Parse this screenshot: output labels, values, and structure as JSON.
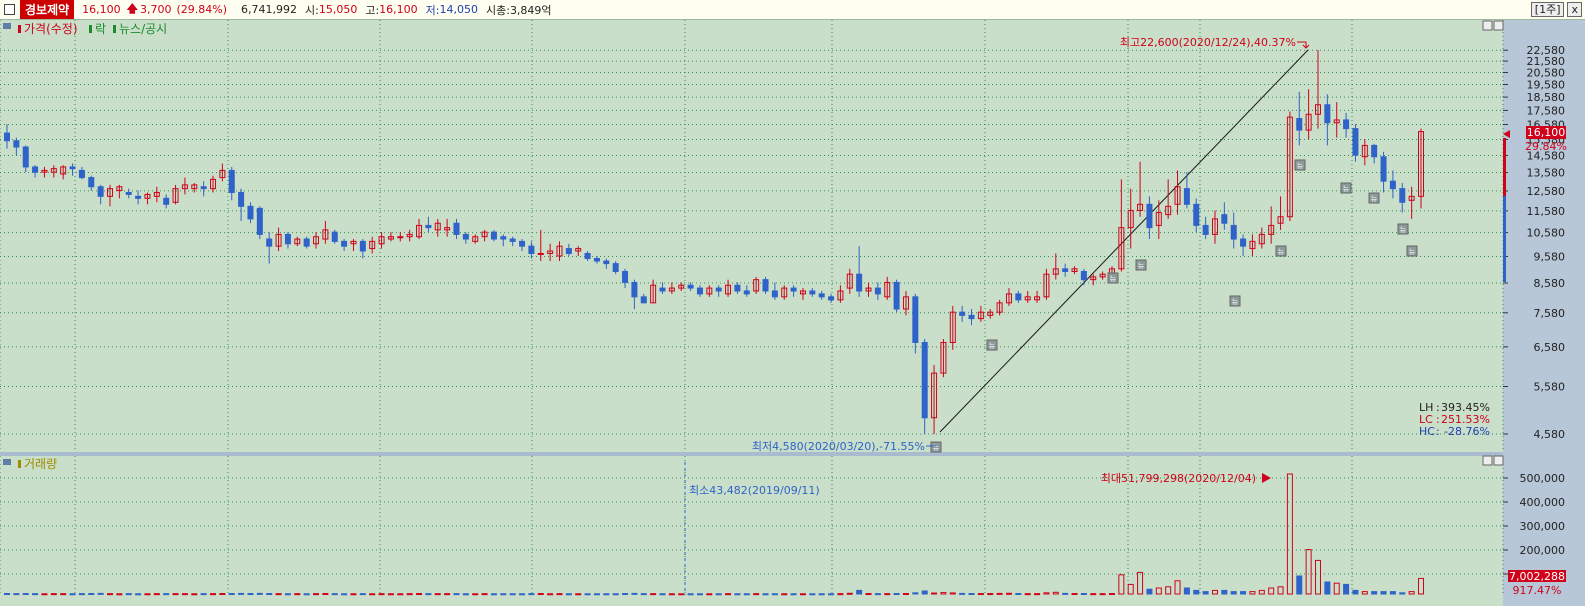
{
  "header": {
    "stock_name": "경보제약",
    "price": "16,100",
    "change": "3,700",
    "change_pct": "(29.84%)",
    "volume": "6,741,992",
    "open_label": "시:",
    "open": "15,050",
    "high_label": "고:",
    "high": "16,100",
    "low_label": "저:",
    "low": "14,050",
    "mcap_label": "시총:",
    "mcap": "3,849억",
    "period_button": "[1주]",
    "close_button": "x"
  },
  "price_panel": {
    "legend_price": "가격(수정)",
    "legend_rak": "락",
    "legend_news": "뉴스/공시",
    "max_annotation": "최고22,600(2020/12/24),40.37%",
    "min_annotation": "최저4,580(2020/03/20),-71.55%",
    "current_price_tag": "16,100",
    "current_pct_tag": "29.84%",
    "stats": [
      {
        "label": "LH",
        "value": "393.45%",
        "color": "#222222"
      },
      {
        "label": "LC",
        "value": "251.53%",
        "color": "#d0021b"
      },
      {
        "label": "HC",
        "value": "-28.76%",
        "color": "#1f3fb0"
      }
    ],
    "news_marker_glyph": "뉴"
  },
  "volume_panel": {
    "legend": "거래량",
    "min_annotation": "최소43,482(2019/09/11)",
    "max_annotation": "최대51,799,298(2020/12/04)",
    "current_volume_tag": "7,002,288",
    "current_pct_tag": "917.47%"
  },
  "colors": {
    "up": "#d0021b",
    "down": "#2f63c9",
    "background": "#c9dfc9",
    "grid": "#2d8f4e",
    "axis": "#b6c6d6"
  },
  "chart_data": {
    "type": "candlestick",
    "period": "weekly",
    "y_ticks": [
      "22,580",
      "21,580",
      "20,580",
      "19,580",
      "18,580",
      "17,580",
      "16,580",
      "15,580",
      "14,580",
      "13,580",
      "12,580",
      "11,580",
      "10,580",
      "9,580",
      "8,580",
      "7,580",
      "6,580",
      "5,580",
      "4,580"
    ],
    "ylim": [
      4580,
      22600
    ],
    "volume_ticks": [
      "500,000",
      "400,000",
      "300,000",
      "200,000",
      "100,000"
    ],
    "volume_unit_note": "",
    "candles": [
      {
        "o": 16000,
        "h": 16600,
        "l": 15000,
        "c": 15500
      },
      {
        "o": 15500,
        "h": 15700,
        "l": 14600,
        "c": 15100
      },
      {
        "o": 15100,
        "h": 15200,
        "l": 13600,
        "c": 13900
      },
      {
        "o": 13900,
        "h": 14000,
        "l": 13300,
        "c": 13600
      },
      {
        "o": 13600,
        "h": 13900,
        "l": 13300,
        "c": 13700
      },
      {
        "o": 13600,
        "h": 14000,
        "l": 13300,
        "c": 13800
      },
      {
        "o": 13500,
        "h": 14000,
        "l": 13200,
        "c": 13900
      },
      {
        "o": 13900,
        "h": 14100,
        "l": 13400,
        "c": 13800
      },
      {
        "o": 13700,
        "h": 13900,
        "l": 13200,
        "c": 13300
      },
      {
        "o": 13300,
        "h": 13400,
        "l": 12600,
        "c": 12800
      },
      {
        "o": 12800,
        "h": 12900,
        "l": 11900,
        "c": 12300
      },
      {
        "o": 12300,
        "h": 12900,
        "l": 11800,
        "c": 12700
      },
      {
        "o": 12600,
        "h": 12900,
        "l": 12200,
        "c": 12800
      },
      {
        "o": 12500,
        "h": 12700,
        "l": 12200,
        "c": 12400
      },
      {
        "o": 12300,
        "h": 12600,
        "l": 11900,
        "c": 12200
      },
      {
        "o": 12200,
        "h": 12500,
        "l": 11900,
        "c": 12400
      },
      {
        "o": 12300,
        "h": 12800,
        "l": 12000,
        "c": 12500
      },
      {
        "o": 12200,
        "h": 12400,
        "l": 11700,
        "c": 11900
      },
      {
        "o": 12000,
        "h": 12900,
        "l": 11900,
        "c": 12700
      },
      {
        "o": 12700,
        "h": 13300,
        "l": 12400,
        "c": 12900
      },
      {
        "o": 12700,
        "h": 13000,
        "l": 12500,
        "c": 12900
      },
      {
        "o": 12800,
        "h": 13100,
        "l": 12300,
        "c": 12700
      },
      {
        "o": 12700,
        "h": 13400,
        "l": 12500,
        "c": 13200
      },
      {
        "o": 13300,
        "h": 14100,
        "l": 13100,
        "c": 13700
      },
      {
        "o": 13700,
        "h": 13900,
        "l": 12100,
        "c": 12500
      },
      {
        "o": 12500,
        "h": 12700,
        "l": 11100,
        "c": 11800
      },
      {
        "o": 11800,
        "h": 12000,
        "l": 11000,
        "c": 11200
      },
      {
        "o": 11700,
        "h": 11800,
        "l": 10300,
        "c": 10500
      },
      {
        "o": 10300,
        "h": 10600,
        "l": 9300,
        "c": 10000
      },
      {
        "o": 10000,
        "h": 10800,
        "l": 9800,
        "c": 10500
      },
      {
        "o": 10500,
        "h": 10600,
        "l": 9900,
        "c": 10100
      },
      {
        "o": 10100,
        "h": 10400,
        "l": 10000,
        "c": 10300
      },
      {
        "o": 10300,
        "h": 10400,
        "l": 9900,
        "c": 10000
      },
      {
        "o": 10100,
        "h": 10600,
        "l": 9900,
        "c": 10400
      },
      {
        "o": 10300,
        "h": 11100,
        "l": 10100,
        "c": 10700
      },
      {
        "o": 10600,
        "h": 10700,
        "l": 10100,
        "c": 10200
      },
      {
        "o": 10200,
        "h": 10300,
        "l": 9800,
        "c": 10000
      },
      {
        "o": 10100,
        "h": 10300,
        "l": 9800,
        "c": 10200
      },
      {
        "o": 10200,
        "h": 10300,
        "l": 9500,
        "c": 9800
      },
      {
        "o": 9900,
        "h": 10400,
        "l": 9700,
        "c": 10200
      },
      {
        "o": 10100,
        "h": 10600,
        "l": 9900,
        "c": 10400
      },
      {
        "o": 10300,
        "h": 10600,
        "l": 10200,
        "c": 10400
      },
      {
        "o": 10400,
        "h": 10600,
        "l": 10200,
        "c": 10400
      },
      {
        "o": 10400,
        "h": 10700,
        "l": 10200,
        "c": 10500
      },
      {
        "o": 10400,
        "h": 11200,
        "l": 10300,
        "c": 10900
      },
      {
        "o": 10900,
        "h": 11300,
        "l": 10600,
        "c": 10800
      },
      {
        "o": 10700,
        "h": 11200,
        "l": 10400,
        "c": 11000
      },
      {
        "o": 10700,
        "h": 11200,
        "l": 10400,
        "c": 10800
      },
      {
        "o": 11000,
        "h": 11200,
        "l": 10300,
        "c": 10500
      },
      {
        "o": 10500,
        "h": 10600,
        "l": 10100,
        "c": 10300
      },
      {
        "o": 10200,
        "h": 10500,
        "l": 10100,
        "c": 10400
      },
      {
        "o": 10400,
        "h": 10700,
        "l": 10200,
        "c": 10600
      },
      {
        "o": 10600,
        "h": 10700,
        "l": 10200,
        "c": 10300
      },
      {
        "o": 10400,
        "h": 10500,
        "l": 10000,
        "c": 10300
      },
      {
        "o": 10300,
        "h": 10400,
        "l": 10000,
        "c": 10200
      },
      {
        "o": 10200,
        "h": 10300,
        "l": 9800,
        "c": 10000
      },
      {
        "o": 10000,
        "h": 10200,
        "l": 9500,
        "c": 9700
      },
      {
        "o": 9700,
        "h": 10700,
        "l": 9400,
        "c": 9700
      },
      {
        "o": 9700,
        "h": 10100,
        "l": 9400,
        "c": 9800
      },
      {
        "o": 9600,
        "h": 10200,
        "l": 9400,
        "c": 10000
      },
      {
        "o": 9900,
        "h": 10100,
        "l": 9600,
        "c": 9700
      },
      {
        "o": 9800,
        "h": 10000,
        "l": 9600,
        "c": 9900
      },
      {
        "o": 9700,
        "h": 9800,
        "l": 9400,
        "c": 9500
      },
      {
        "o": 9500,
        "h": 9600,
        "l": 9300,
        "c": 9400
      },
      {
        "o": 9400,
        "h": 9500,
        "l": 9100,
        "c": 9300
      },
      {
        "o": 9300,
        "h": 9400,
        "l": 8900,
        "c": 9000
      },
      {
        "o": 9000,
        "h": 9100,
        "l": 8400,
        "c": 8600
      },
      {
        "o": 8600,
        "h": 8700,
        "l": 7700,
        "c": 8100
      },
      {
        "o": 8100,
        "h": 8200,
        "l": 7900,
        "c": 7900
      },
      {
        "o": 7900,
        "h": 8700,
        "l": 7900,
        "c": 8500
      },
      {
        "o": 8400,
        "h": 8600,
        "l": 8200,
        "c": 8300
      },
      {
        "o": 8300,
        "h": 8600,
        "l": 8200,
        "c": 8400
      },
      {
        "o": 8400,
        "h": 8600,
        "l": 8300,
        "c": 8500
      },
      {
        "o": 8500,
        "h": 8600,
        "l": 8300,
        "c": 8400
      },
      {
        "o": 8400,
        "h": 8500,
        "l": 8100,
        "c": 8200
      },
      {
        "o": 8200,
        "h": 8500,
        "l": 8100,
        "c": 8400
      },
      {
        "o": 8400,
        "h": 8500,
        "l": 8100,
        "c": 8300
      },
      {
        "o": 8200,
        "h": 8700,
        "l": 8100,
        "c": 8500
      },
      {
        "o": 8500,
        "h": 8600,
        "l": 8200,
        "c": 8300
      },
      {
        "o": 8300,
        "h": 8500,
        "l": 8100,
        "c": 8200
      },
      {
        "o": 8300,
        "h": 8800,
        "l": 8200,
        "c": 8700
      },
      {
        "o": 8700,
        "h": 8800,
        "l": 8200,
        "c": 8300
      },
      {
        "o": 8300,
        "h": 8600,
        "l": 8000,
        "c": 8100
      },
      {
        "o": 8100,
        "h": 8500,
        "l": 8000,
        "c": 8400
      },
      {
        "o": 8400,
        "h": 8500,
        "l": 8100,
        "c": 8300
      },
      {
        "o": 8200,
        "h": 8400,
        "l": 8000,
        "c": 8300
      },
      {
        "o": 8300,
        "h": 8400,
        "l": 8100,
        "c": 8200
      },
      {
        "o": 8200,
        "h": 8300,
        "l": 8000,
        "c": 8100
      },
      {
        "o": 8100,
        "h": 8200,
        "l": 7900,
        "c": 8000
      },
      {
        "o": 8000,
        "h": 8500,
        "l": 7900,
        "c": 8300
      },
      {
        "o": 8400,
        "h": 9100,
        "l": 8200,
        "c": 8900
      },
      {
        "o": 8900,
        "h": 10000,
        "l": 8100,
        "c": 8300
      },
      {
        "o": 8300,
        "h": 8600,
        "l": 8100,
        "c": 8400
      },
      {
        "o": 8400,
        "h": 8600,
        "l": 8000,
        "c": 8200
      },
      {
        "o": 8100,
        "h": 8800,
        "l": 8000,
        "c": 8600
      },
      {
        "o": 8600,
        "h": 8700,
        "l": 7600,
        "c": 7700
      },
      {
        "o": 7700,
        "h": 8300,
        "l": 7500,
        "c": 8100
      },
      {
        "o": 8100,
        "h": 8200,
        "l": 6400,
        "c": 6700
      },
      {
        "o": 6700,
        "h": 6800,
        "l": 4580,
        "c": 4900
      },
      {
        "o": 4900,
        "h": 6100,
        "l": 4580,
        "c": 5900
      },
      {
        "o": 5900,
        "h": 6800,
        "l": 5800,
        "c": 6700
      },
      {
        "o": 6700,
        "h": 7800,
        "l": 6500,
        "c": 7600
      },
      {
        "o": 7600,
        "h": 7800,
        "l": 7300,
        "c": 7500
      },
      {
        "o": 7500,
        "h": 7700,
        "l": 7200,
        "c": 7400
      },
      {
        "o": 7400,
        "h": 7800,
        "l": 7300,
        "c": 7600
      },
      {
        "o": 7500,
        "h": 7700,
        "l": 7400,
        "c": 7600
      },
      {
        "o": 7600,
        "h": 8000,
        "l": 7500,
        "c": 7900
      },
      {
        "o": 7900,
        "h": 8400,
        "l": 7800,
        "c": 8200
      },
      {
        "o": 8200,
        "h": 8300,
        "l": 7900,
        "c": 8000
      },
      {
        "o": 8000,
        "h": 8300,
        "l": 7900,
        "c": 8100
      },
      {
        "o": 8000,
        "h": 8300,
        "l": 7900,
        "c": 8100
      },
      {
        "o": 8100,
        "h": 9100,
        "l": 8000,
        "c": 8900
      },
      {
        "o": 8900,
        "h": 9700,
        "l": 8700,
        "c": 9100
      },
      {
        "o": 9100,
        "h": 9300,
        "l": 8800,
        "c": 9000
      },
      {
        "o": 9000,
        "h": 9200,
        "l": 8900,
        "c": 9100
      },
      {
        "o": 9000,
        "h": 9100,
        "l": 8500,
        "c": 8700
      },
      {
        "o": 8700,
        "h": 8900,
        "l": 8500,
        "c": 8800
      },
      {
        "o": 8800,
        "h": 9000,
        "l": 8700,
        "c": 8900
      },
      {
        "o": 8800,
        "h": 9200,
        "l": 8600,
        "c": 9100
      },
      {
        "o": 9100,
        "h": 13200,
        "l": 9000,
        "c": 10800
      },
      {
        "o": 10800,
        "h": 12700,
        "l": 9900,
        "c": 11600
      },
      {
        "o": 11600,
        "h": 14200,
        "l": 11300,
        "c": 11900
      },
      {
        "o": 11900,
        "h": 12300,
        "l": 10300,
        "c": 10800
      },
      {
        "o": 10900,
        "h": 12100,
        "l": 10300,
        "c": 11500
      },
      {
        "o": 11400,
        "h": 13200,
        "l": 11200,
        "c": 11800
      },
      {
        "o": 11900,
        "h": 13700,
        "l": 11400,
        "c": 12800
      },
      {
        "o": 12700,
        "h": 13600,
        "l": 11700,
        "c": 11900
      },
      {
        "o": 11900,
        "h": 12200,
        "l": 10600,
        "c": 10900
      },
      {
        "o": 10900,
        "h": 11300,
        "l": 10300,
        "c": 10500
      },
      {
        "o": 10500,
        "h": 11600,
        "l": 10100,
        "c": 11200
      },
      {
        "o": 11400,
        "h": 12000,
        "l": 10700,
        "c": 11000
      },
      {
        "o": 10900,
        "h": 11500,
        "l": 9900,
        "c": 10300
      },
      {
        "o": 10300,
        "h": 10500,
        "l": 9600,
        "c": 10000
      },
      {
        "o": 9900,
        "h": 10500,
        "l": 9600,
        "c": 10200
      },
      {
        "o": 10100,
        "h": 10800,
        "l": 9900,
        "c": 10500
      },
      {
        "o": 10500,
        "h": 11800,
        "l": 10100,
        "c": 10900
      },
      {
        "o": 11000,
        "h": 12300,
        "l": 10700,
        "c": 11300
      },
      {
        "o": 11300,
        "h": 17500,
        "l": 11100,
        "c": 17100
      },
      {
        "o": 17000,
        "h": 19000,
        "l": 15200,
        "c": 16200
      },
      {
        "o": 16200,
        "h": 19200,
        "l": 15600,
        "c": 17300
      },
      {
        "o": 17300,
        "h": 22600,
        "l": 16300,
        "c": 18000
      },
      {
        "o": 18000,
        "h": 18800,
        "l": 15200,
        "c": 16700
      },
      {
        "o": 16700,
        "h": 18200,
        "l": 15700,
        "c": 16900
      },
      {
        "o": 16900,
        "h": 17400,
        "l": 15700,
        "c": 16300
      },
      {
        "o": 16300,
        "h": 16600,
        "l": 14200,
        "c": 14600
      },
      {
        "o": 14500,
        "h": 15600,
        "l": 14000,
        "c": 15200
      },
      {
        "o": 15200,
        "h": 15300,
        "l": 14100,
        "c": 14500
      },
      {
        "o": 14500,
        "h": 14800,
        "l": 12500,
        "c": 13100
      },
      {
        "o": 13100,
        "h": 13700,
        "l": 12200,
        "c": 12700
      },
      {
        "o": 12700,
        "h": 13000,
        "l": 11500,
        "c": 12000
      },
      {
        "o": 12100,
        "h": 12800,
        "l": 11200,
        "c": 12300
      },
      {
        "o": 12300,
        "h": 16300,
        "l": 11700,
        "c": 16100
      }
    ],
    "volumes": [
      0.004,
      0.003,
      0.004,
      0.003,
      0.002,
      0.003,
      0.003,
      0.002,
      0.003,
      0.004,
      0.005,
      0.003,
      0.002,
      0.003,
      0.002,
      0.002,
      0.003,
      0.003,
      0.003,
      0.003,
      0.002,
      0.003,
      0.003,
      0.004,
      0.004,
      0.005,
      0.004,
      0.005,
      0.004,
      0.003,
      0.002,
      0.003,
      0.002,
      0.003,
      0.004,
      0.003,
      0.002,
      0.002,
      0.003,
      0.002,
      0.003,
      0.002,
      0.002,
      0.003,
      0.004,
      0.003,
      0.003,
      0.003,
      0.003,
      0.002,
      0.002,
      0.003,
      0.002,
      0.002,
      0.002,
      0.002,
      0.003,
      0.004,
      0.002,
      0.003,
      0.002,
      0.002,
      0.002,
      0.002,
      0.002,
      0.002,
      0.004,
      0.005,
      0.003,
      0.003,
      0.002,
      0.002,
      0.002,
      0.002,
      0.002,
      0.002,
      0.002,
      0.003,
      0.002,
      0.002,
      0.003,
      0.002,
      0.002,
      0.002,
      0.002,
      0.002,
      0.002,
      0.002,
      0.002,
      0.003,
      0.006,
      0.03,
      0.004,
      0.003,
      0.003,
      0.004,
      0.004,
      0.01,
      0.025,
      0.008,
      0.012,
      0.009,
      0.005,
      0.004,
      0.004,
      0.004,
      0.005,
      0.006,
      0.004,
      0.003,
      0.003,
      0.01,
      0.014,
      0.005,
      0.004,
      0.004,
      0.003,
      0.003,
      0.004,
      0.16,
      0.08,
      0.18,
      0.04,
      0.05,
      0.06,
      0.11,
      0.05,
      0.03,
      0.02,
      0.03,
      0.03,
      0.02,
      0.02,
      0.02,
      0.03,
      0.05,
      0.06,
      1.0,
      0.15,
      0.37,
      0.28,
      0.1,
      0.09,
      0.08,
      0.03,
      0.02,
      0.02,
      0.02,
      0.02,
      0.01,
      0.02,
      0.13
    ]
  }
}
